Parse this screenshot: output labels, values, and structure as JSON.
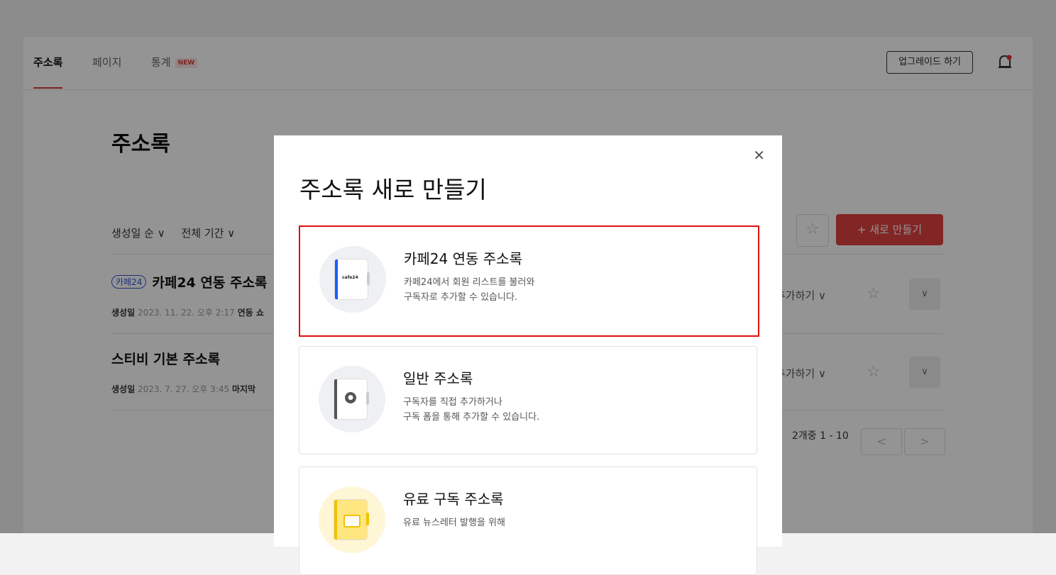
{
  "nav": {
    "tabs": [
      {
        "label": "주소록",
        "active": true
      },
      {
        "label": "페이지",
        "active": false
      },
      {
        "label": "통계",
        "badge": "NEW",
        "active": false
      }
    ],
    "upgrade_label": "업그레이드 하기"
  },
  "page": {
    "title": "주소록",
    "filters": [
      "생성일 순 ∨",
      "전체 기간 ∨"
    ],
    "new_button": "+ 새로 만들기",
    "rows": [
      {
        "chip": "카페24",
        "title": "카페24 연동 주소록",
        "meta_label": "생성일",
        "meta_date": "2023. 11. 22. 오후 2:17",
        "meta_extra": "연동 쇼",
        "action": "추가하기 ∨"
      },
      {
        "chip": "",
        "title": "스티비 기본 주소록",
        "meta_label": "생성일",
        "meta_date": "2023. 7. 27. 오후 3:45",
        "meta_extra": "마지막 ",
        "action": "추가하기 ∨"
      }
    ],
    "pagination": "2개중 1 - 10"
  },
  "modal": {
    "title": "주소록 새로 만들기",
    "options": [
      {
        "title": "카페24 연동 주소록",
        "desc_line1": "카페24에서 회원 리스트를 불러와",
        "desc_line2": "구독자로 추가할 수 있습니다.",
        "icon": "cafe24-addressbook-icon",
        "logo_text": "cafe24",
        "accent": "#1a5cff"
      },
      {
        "title": "일반 주소록",
        "desc_line1": "구독자를 직접 추가하거나",
        "desc_line2": "구독 폼을 통해 추가할 수 있습니다.",
        "icon": "general-addressbook-icon",
        "accent": "#555555"
      },
      {
        "title": "유료 구독 주소록",
        "desc_line1": "유료 뉴스레터 발행을 위해",
        "desc_line2": "",
        "icon": "paid-addressbook-icon",
        "accent": "#f2c200"
      }
    ]
  },
  "colors": {
    "accent_red": "#e04040",
    "selection_border": "#e01010",
    "overlay": "rgba(0,0,0,0.42)"
  }
}
